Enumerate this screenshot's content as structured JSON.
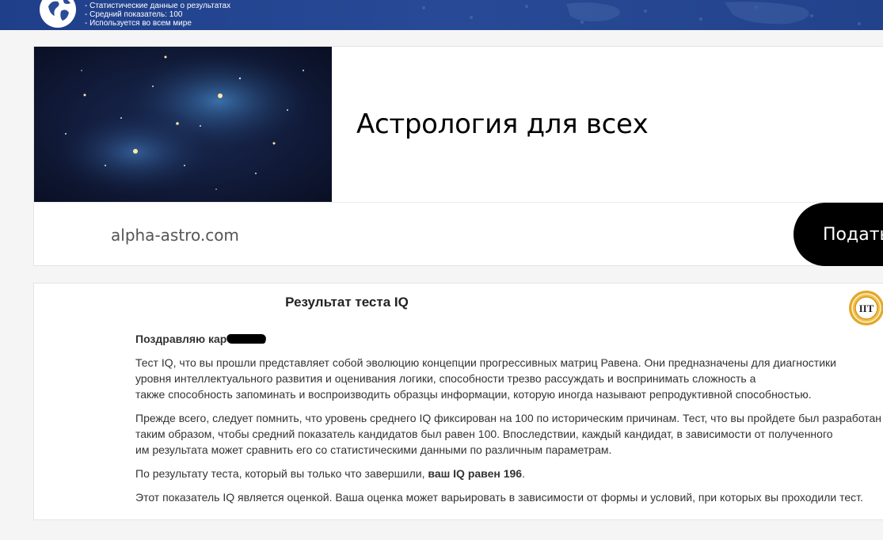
{
  "header": {
    "lines": [
      "- Статистические данные о результатах",
      "- Средний показатель: 100",
      "- Используется во всем мире"
    ]
  },
  "ad": {
    "title": "Астрология для всех",
    "domain": "alpha-astro.com",
    "button_label": "Подать"
  },
  "result": {
    "title": "Результат теста IQ",
    "badge_text": "IIT",
    "greeting": "Поздравляю кар",
    "paragraphs": [
      [
        "Тест IQ, что вы прошли представляет собой эволюцию концепции прогрессивных матриц Равена. Они предназначены для диагностики",
        "уровня интеллектуального развития и оценивания логики, способности трезво рассуждать и воспринимать сложность а",
        "также способность запоминать и воспроизводить образцы информации, которую иногда называют репродуктивной способностью."
      ],
      [
        "Прежде всего, следует помнить, что уровень среднего IQ фиксирован на 100 по историческим причинам. Тест, что вы пройдете был разработан",
        "таким образом, чтобы средний показатель кандидатов был равен 100. Впоследствии, каждый кандидат, в зависимости от полученного",
        "им результата может сравнить его со статистическими данными по различным параметрам."
      ]
    ],
    "score_prefix": "По результату теста, который вы только что завершили, ",
    "score_bold": "ваш IQ равен 196",
    "score_suffix": ".",
    "last_paragraph": "Этот показатель IQ является оценкой. Ваша оценка может варьировать в зависимости от формы и условий, при которых вы проходили тест."
  }
}
